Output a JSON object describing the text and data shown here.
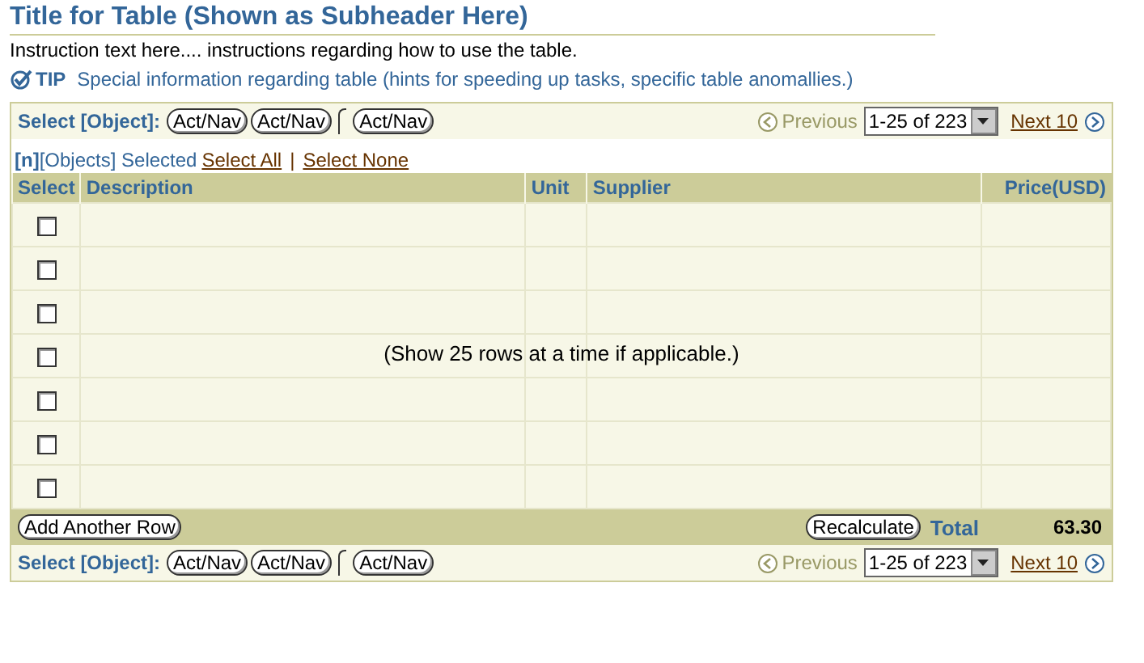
{
  "title": "Title for Table (Shown as Subheader Here)",
  "instruction": "Instruction text here.... instructions regarding how to use the table.",
  "tip": {
    "label": "TIP",
    "text": "Special information regarding table (hints for speeding up tasks, specific table anomallies.)"
  },
  "top_controls": {
    "select_label": "Select [Object]:",
    "buttons": [
      "Act/Nav",
      "Act/Nav",
      "Act/Nav"
    ],
    "previous": {
      "label": "Previous",
      "disabled": true
    },
    "range": "1-25 of 223",
    "next": {
      "label": "Next 10",
      "disabled": false
    }
  },
  "selection": {
    "count": "[n]",
    "text": "[Objects] Selected",
    "select_all": "Select All",
    "separator": "|",
    "select_none": "Select None"
  },
  "table": {
    "columns": [
      "Select",
      "Description",
      "Unit",
      "Supplier",
      "Price(USD)"
    ],
    "rows": [
      {
        "checked": false
      },
      {
        "checked": false
      },
      {
        "checked": false
      },
      {
        "checked": false
      },
      {
        "checked": false
      },
      {
        "checked": false
      },
      {
        "checked": false
      }
    ],
    "message": "(Show 25 rows at a time if applicable.)"
  },
  "footer": {
    "add_button": "Add Another Row",
    "recalculate_button": "Recalculate",
    "total_label": "Total",
    "total_value": "63.30"
  },
  "bottom_controls": {
    "select_label": "Select [Object]:",
    "buttons": [
      "Act/Nav",
      "Act/Nav",
      "Act/Nav"
    ],
    "previous": {
      "label": "Previous",
      "disabled": true
    },
    "range": "1-25 of 223",
    "next": {
      "label": "Next 10",
      "disabled": false
    }
  }
}
